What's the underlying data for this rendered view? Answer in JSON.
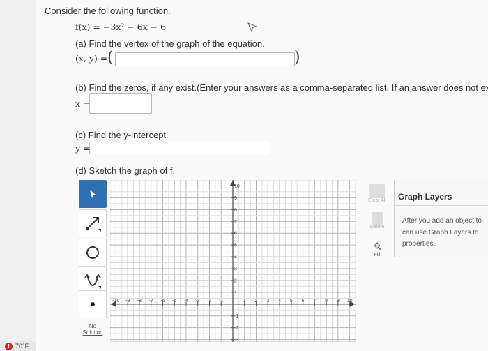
{
  "problem": {
    "intro": "Consider the following function.",
    "function": "f(x) = −3x² − 6x − 6",
    "part_a": {
      "prompt": "(a) Find the vertex of the graph of the equation.",
      "label": "(x, y) =",
      "value": ""
    },
    "part_b": {
      "prompt": "(b) Find the zeros, if any exist.(Enter your answers as a comma-separated list. If an answer does not exist",
      "label": "x =",
      "value": ""
    },
    "part_c": {
      "prompt": "(c) Find the y-intercept.",
      "label": "y =",
      "value": ""
    },
    "part_d": {
      "prompt": "(d) Sketch the graph of f."
    }
  },
  "graph": {
    "x_range": [
      -10.5,
      10.5
    ],
    "y_range": [
      -3.2,
      10.5
    ],
    "x_ticks": [
      -10,
      -9,
      -8,
      -7,
      -6,
      -5,
      -4,
      -3,
      -2,
      -1,
      1,
      2,
      3,
      4,
      5,
      6,
      7,
      8,
      9,
      10
    ],
    "y_ticks": [
      -3,
      -2,
      -1,
      1,
      2,
      3,
      4,
      5,
      6,
      7,
      8,
      9,
      10
    ],
    "grid": true
  },
  "toolbar": {
    "tools": [
      {
        "name": "pointer",
        "icon": "pointer-arrow-icon",
        "active": true
      },
      {
        "name": "line",
        "icon": "line-tool-icon",
        "active": false
      },
      {
        "name": "circle",
        "icon": "circle-tool-icon",
        "active": false
      },
      {
        "name": "parabola",
        "icon": "parabola-tool-icon",
        "active": false
      },
      {
        "name": "point",
        "icon": "point-tool-icon",
        "active": false
      }
    ],
    "no_solution_line1": "No",
    "no_solution_line2": "Solution"
  },
  "side_tools": {
    "clear_all": "Clear All",
    "delete": "Delete",
    "fill": "Fill"
  },
  "layers_panel": {
    "title": "Graph Layers",
    "line1": "After you add an object to",
    "line2": "can use Graph Layers to",
    "line3": "properties."
  },
  "taskbar": {
    "alert_count": "1",
    "temperature": "70°F"
  }
}
